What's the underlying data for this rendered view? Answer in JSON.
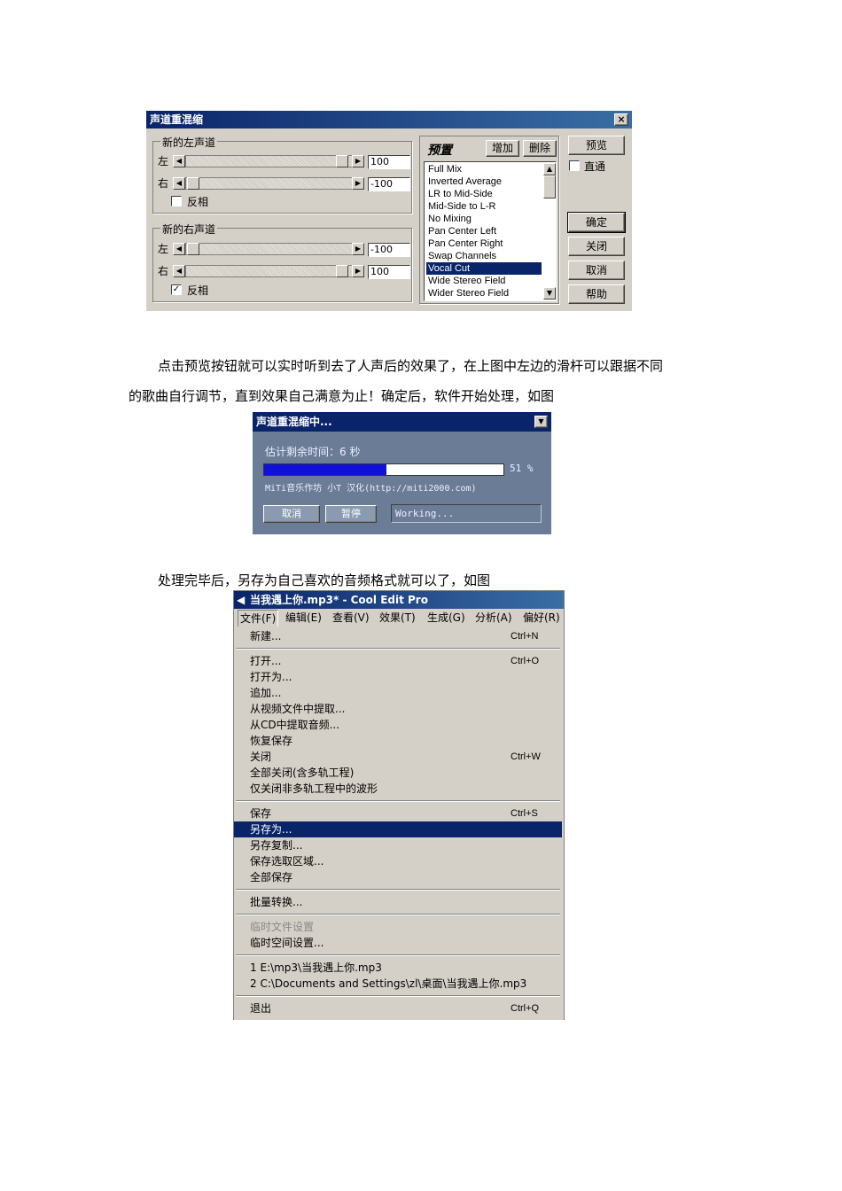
{
  "dialog1": {
    "title": "声道重混缩",
    "close": "×",
    "left_group": "新的左声道",
    "right_group": "新的右声道",
    "left_label": "左",
    "right_label": "右",
    "invert_label": "反相",
    "newleft_left_value": "100",
    "newleft_right_value": "-100",
    "newright_left_value": "-100",
    "newright_right_value": "100",
    "newleft_invert": "",
    "newright_invert": "✓",
    "preset_title": "预置",
    "add_button": "增加",
    "delete_button": "删除",
    "preset_items": [
      "Full Mix",
      "Inverted Average",
      "LR to Mid-Side",
      "Mid-Side to L-R",
      "No Mixing",
      "Pan Center Left",
      "Pan Center Right",
      "Swap Channels",
      "Vocal Cut",
      "Wide Stereo Field",
      "Wider Stereo Field"
    ],
    "selected_preset": "Vocal Cut",
    "preview_button": "预览",
    "bypass_label": "直通",
    "ok_button": "确定",
    "close_button": "关闭",
    "cancel_button": "取消",
    "help_button": "帮助"
  },
  "para1_line1": "点击预览按钮就可以实时听到去了人声后的效果了，在上图中左边的滑杆可以跟据不同",
  "para1_line2": "的歌曲自行调节，直到效果自己满意为止！确定后，软件开始处理，如图",
  "dialog2": {
    "title": "声道重混缩中...",
    "remaining": "估计剩余时间：6 秒",
    "progress": 0.51,
    "percent": "51 %",
    "credit": "MiTi音乐作坊 小T 汉化(http://miti2000.com)",
    "cancel_button": "取消",
    "pause_button": "暂停",
    "status": "Working..."
  },
  "para2": "处理完毕后，另存为自己喜欢的音频格式就可以了，如图",
  "window3": {
    "title": "当我遇上你.mp3* - Cool Edit Pro",
    "menubar": [
      "文件(F)",
      "编辑(E)",
      "查看(V)",
      "效果(T)",
      "生成(G)",
      "分析(A)",
      "偏好(R)"
    ],
    "items": [
      {
        "label": "新建...",
        "shortcut": "Ctrl+N"
      },
      {
        "label": "打开...",
        "shortcut": "Ctrl+O"
      },
      {
        "label": "打开为...",
        "shortcut": ""
      },
      {
        "label": "追加...",
        "shortcut": ""
      },
      {
        "label": "从视频文件中提取...",
        "shortcut": ""
      },
      {
        "label": "从CD中提取音频...",
        "shortcut": ""
      },
      {
        "label": "恢复保存",
        "shortcut": ""
      },
      {
        "label": "关闭",
        "shortcut": "Ctrl+W"
      },
      {
        "label": "全部关闭(含多轨工程)",
        "shortcut": ""
      },
      {
        "label": "仅关闭非多轨工程中的波形",
        "shortcut": ""
      },
      {
        "label": "保存",
        "shortcut": "Ctrl+S"
      },
      {
        "label": "另存为...",
        "shortcut": ""
      },
      {
        "label": "另存复制...",
        "shortcut": ""
      },
      {
        "label": "保存选取区域...",
        "shortcut": ""
      },
      {
        "label": "全部保存",
        "shortcut": ""
      },
      {
        "label": "批量转换...",
        "shortcut": ""
      },
      {
        "label": "临时文件设置",
        "shortcut": ""
      },
      {
        "label": "临时空间设置...",
        "shortcut": ""
      },
      {
        "label": "1 E:\\mp3\\当我遇上你.mp3",
        "shortcut": ""
      },
      {
        "label": "2 C:\\Documents and Settings\\zl\\桌面\\当我遇上你.mp3",
        "shortcut": ""
      },
      {
        "label": "退出",
        "shortcut": "Ctrl+Q"
      }
    ]
  }
}
